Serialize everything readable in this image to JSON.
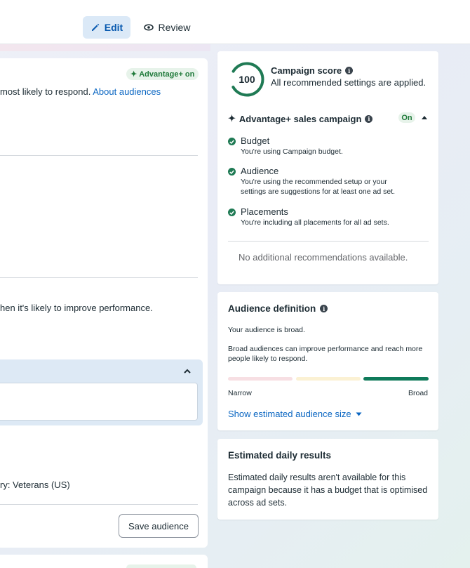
{
  "toolbar": {
    "edit_label": "Edit",
    "review_label": "Review"
  },
  "left": {
    "advantage_pill": "Advantage+ on",
    "audience_text_prefix": "most likely to respond.",
    "audience_link": "About audiences",
    "performance_text": "hen it's likely to improve performance.",
    "category_text": "ry: Veterans (US)",
    "save_audience_label": "Save audience"
  },
  "score_card": {
    "score": "100",
    "title": "Campaign score",
    "subtitle": "All recommended settings are applied.",
    "advantage_title": "Advantage+ sales campaign",
    "advantage_status": "On",
    "items": [
      {
        "title": "Budget",
        "sub_prefix": "You're using ",
        "sub_bold": "Campaign budget",
        "sub_suffix": "."
      },
      {
        "title": "Audience",
        "sub1": "You're using the recommended setup or your",
        "sub2": "settings are suggestions for at least one ad set."
      },
      {
        "title": "Placements",
        "sub": "You're including all placements for all ad sets."
      }
    ],
    "no_recommendations": "No additional recommendations available."
  },
  "audience_card": {
    "title": "Audience definition",
    "status": "Your audience is broad.",
    "desc1": "Broad audiences can improve performance and reach more",
    "desc2": "people likely to respond.",
    "narrow_label": "Narrow",
    "broad_label": "Broad",
    "level": "broad",
    "show_size_label": "Show estimated audience size"
  },
  "estimate_card": {
    "title": "Estimated daily results",
    "body": "Estimated daily results aren't available for this campaign because it has a budget that is optimised across ad sets."
  },
  "colors": {
    "accent": "#0a66c2",
    "success": "#1f7a54",
    "bar_narrow": "#f7dfe3",
    "bar_mid": "#fbf1d3",
    "bar_broad": "#0f7a5a"
  }
}
